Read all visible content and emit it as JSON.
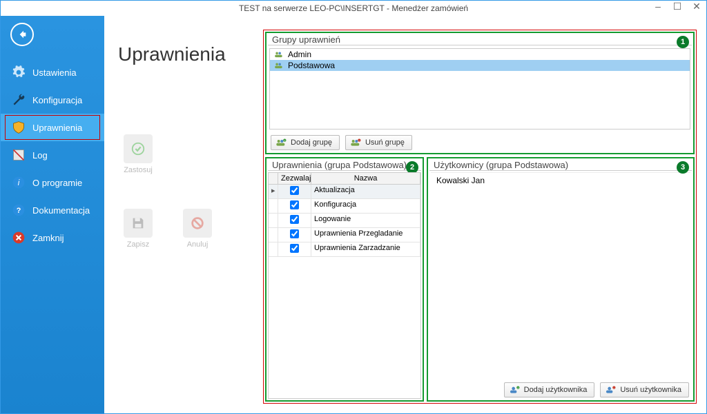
{
  "window_title": "TEST na serwerze LEO-PC\\INSERTGT - Menedżer zamówień",
  "page_title": "Uprawnienia",
  "sidebar": {
    "items": [
      {
        "label": "Ustawienia",
        "icon": "gear"
      },
      {
        "label": "Konfiguracja",
        "icon": "wrench"
      },
      {
        "label": "Uprawnienia",
        "icon": "shield",
        "active": true,
        "outlined": true
      },
      {
        "label": "Log",
        "icon": "log"
      },
      {
        "label": "O programie",
        "icon": "info"
      },
      {
        "label": "Dokumentacja",
        "icon": "help"
      },
      {
        "label": "Zamknij",
        "icon": "close"
      }
    ]
  },
  "actions": {
    "apply": "Zastosuj",
    "save": "Zapisz",
    "cancel": "Anuluj"
  },
  "groups_panel": {
    "title": "Grupy uprawnień",
    "badge": "1",
    "items": [
      {
        "name": "Admin",
        "selected": false
      },
      {
        "name": "Podstawowa",
        "selected": true
      }
    ],
    "add_label": "Dodaj grupę",
    "del_label": "Usuń grupę"
  },
  "perms_panel": {
    "title": "Uprawnienia (grupa Podstawowa)",
    "badge": "2",
    "col_allow": "Zezwalaj",
    "col_name": "Nazwa",
    "rows": [
      {
        "allow": true,
        "name": "Aktualizacja",
        "current": true
      },
      {
        "allow": true,
        "name": "Konfiguracja"
      },
      {
        "allow": true,
        "name": "Logowanie"
      },
      {
        "allow": true,
        "name": "Uprawnienia Przegladanie"
      },
      {
        "allow": true,
        "name": "Uprawnienia Zarzadzanie"
      }
    ]
  },
  "users_panel": {
    "title": "Użytkownicy (grupa Podstawowa)",
    "badge": "3",
    "items": [
      "Kowalski Jan"
    ],
    "add_label": "Dodaj użytkownika",
    "del_label": "Usuń użytkownika"
  }
}
